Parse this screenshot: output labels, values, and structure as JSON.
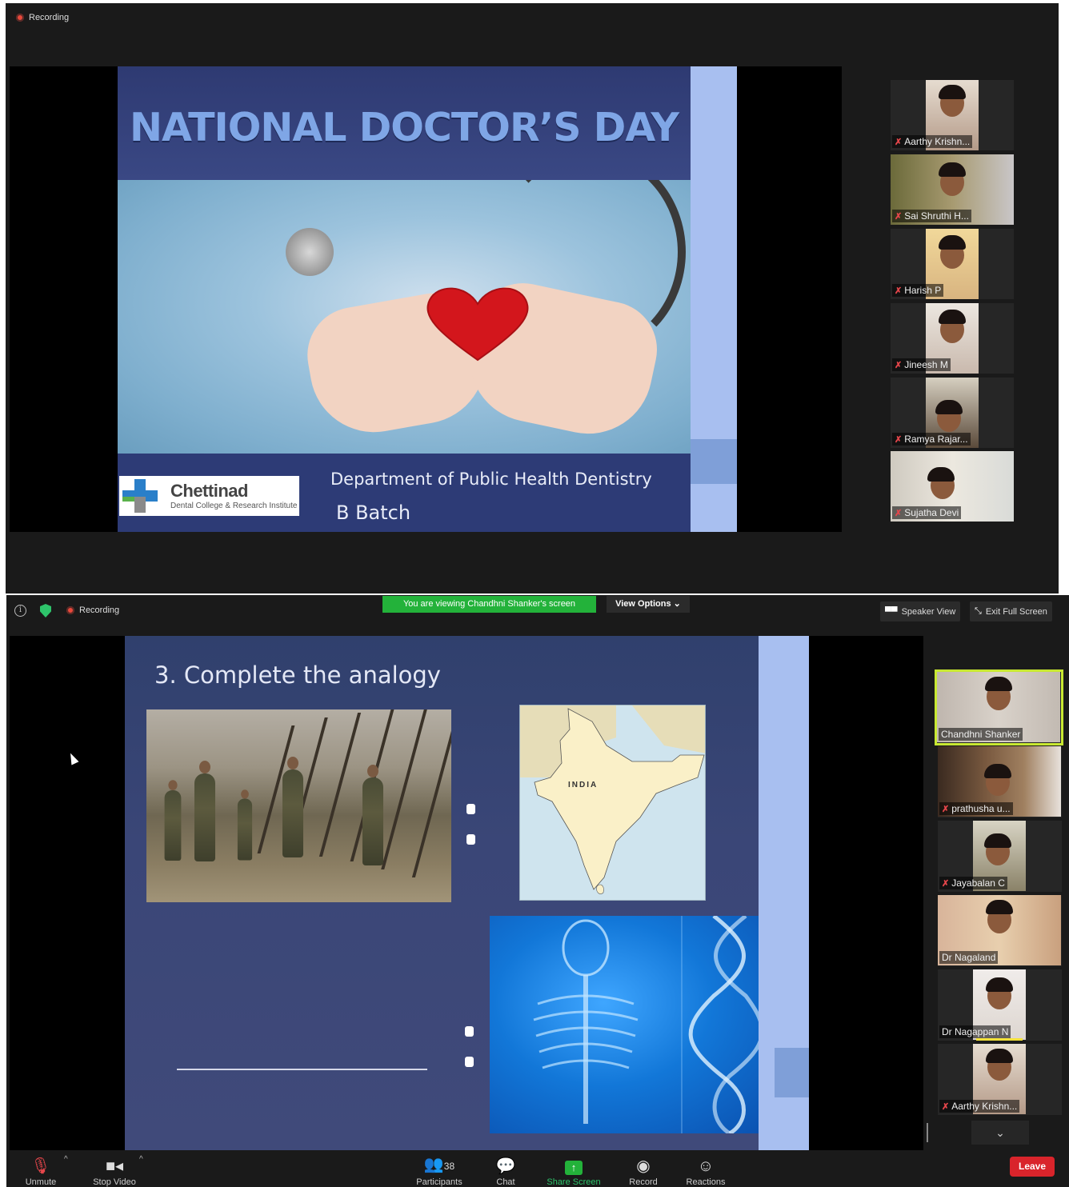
{
  "top_window": {
    "recording": "Recording",
    "slide": {
      "title": "NATIONAL DOCTOR’S DAY",
      "logo_name": "Chettinad",
      "logo_sub": "Dental College & Research Institute",
      "department": "Department of  Public Health Dentistry",
      "batch": "B Batch"
    },
    "participants": [
      {
        "name": "Aarthy Krishn...",
        "muted": true
      },
      {
        "name": "Sai Shruthi H...",
        "muted": true
      },
      {
        "name": "Harish P",
        "muted": true
      },
      {
        "name": "Jineesh M",
        "muted": true
      },
      {
        "name": "Ramya Rajar...",
        "muted": true
      },
      {
        "name": "Sujatha Devi",
        "muted": true
      }
    ]
  },
  "bottom_window": {
    "recording": "Recording",
    "banner": "You are viewing Chandhni Shanker's screen",
    "view_options": "View Options",
    "speaker_view": "Speaker View",
    "exit_full_screen": "Exit Full Screen",
    "slide": {
      "title": "3. Complete the analogy",
      "map_label": "INDIA"
    },
    "participants": [
      {
        "name": "Chandhni Shanker",
        "muted": false,
        "active": true
      },
      {
        "name": "prathusha u...",
        "muted": true
      },
      {
        "name": "Jayabalan C",
        "muted": true
      },
      {
        "name": "Dr Nagaland",
        "muted": false
      },
      {
        "name": "Dr Nagappan N",
        "muted": false
      },
      {
        "name": "Aarthy Krishn...",
        "muted": true
      }
    ],
    "toolbar": {
      "unmute": "Unmute",
      "stop_video": "Stop Video",
      "participants": "Participants",
      "participant_count": "38",
      "chat": "Chat",
      "share_screen": "Share Screen",
      "record": "Record",
      "reactions": "Reactions",
      "leave": "Leave"
    },
    "colors": {
      "share_green": "#23b23a",
      "leave_red": "#d9242b",
      "active_outline": "#c8e832"
    }
  }
}
